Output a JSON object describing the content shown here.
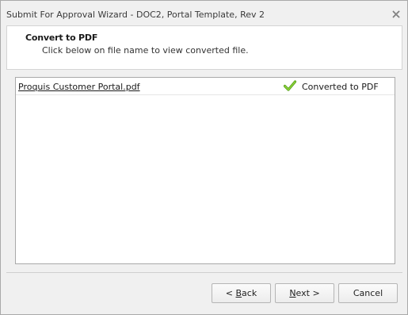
{
  "window": {
    "title": "Submit For Approval Wizard - DOC2, Portal Template, Rev 2",
    "close_icon": "close-icon"
  },
  "header": {
    "title": "Convert to PDF",
    "subtitle": "Click below on file name to view converted file."
  },
  "files": [
    {
      "name": "Proquis Customer Portal.pdf",
      "status": "Converted to PDF",
      "status_icon": "checkmark-icon",
      "status_color": "#6bbf1f"
    }
  ],
  "buttons": {
    "back": {
      "pre": "< ",
      "accel": "B",
      "post": "ack"
    },
    "next": {
      "accel": "N",
      "post": "ext >"
    },
    "cancel": "Cancel"
  }
}
